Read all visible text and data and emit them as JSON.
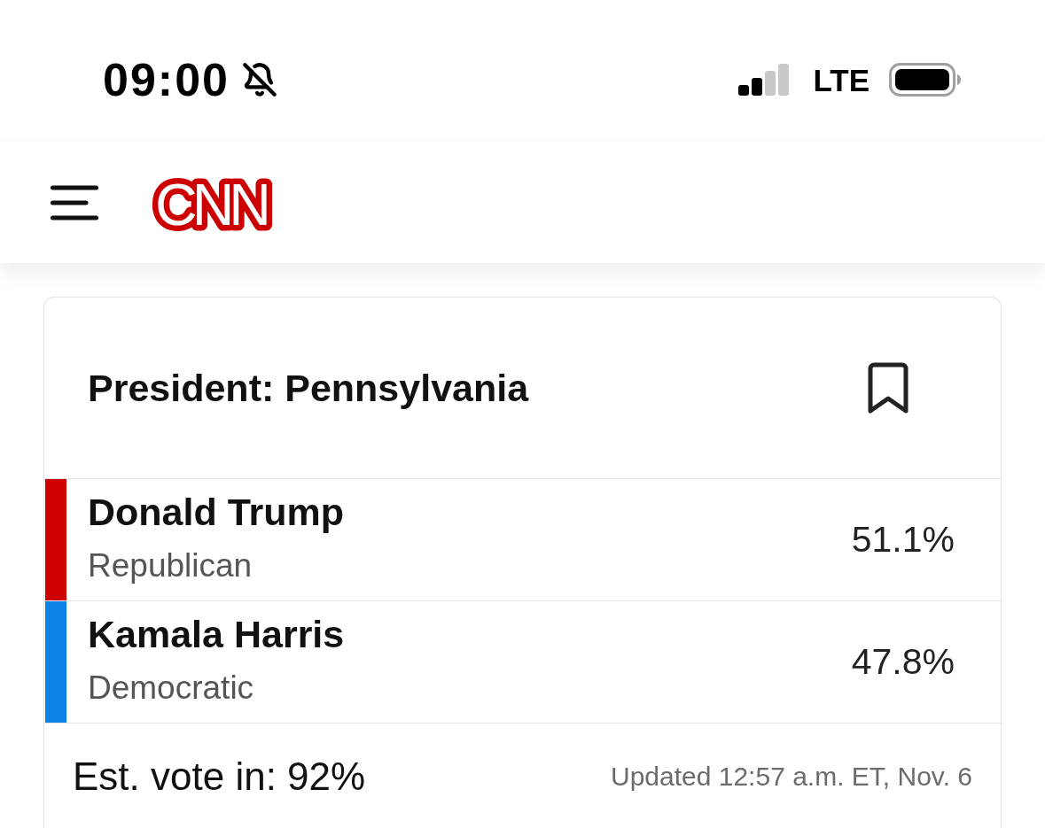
{
  "status_bar": {
    "time": "09:00",
    "network": "LTE"
  },
  "header": {
    "logo": "CNN"
  },
  "race": {
    "title": "President: Pennsylvania"
  },
  "candidates": [
    {
      "name": "Donald Trump",
      "party": "Republican",
      "percent": "51.1%",
      "color": "#cc0000"
    },
    {
      "name": "Kamala Harris",
      "party": "Democratic",
      "percent": "47.8%",
      "color": "#0c84e6"
    }
  ],
  "footer": {
    "vote_in": "Est. vote in: 92%",
    "updated": "Updated 12:57 a.m. ET, Nov. 6"
  }
}
